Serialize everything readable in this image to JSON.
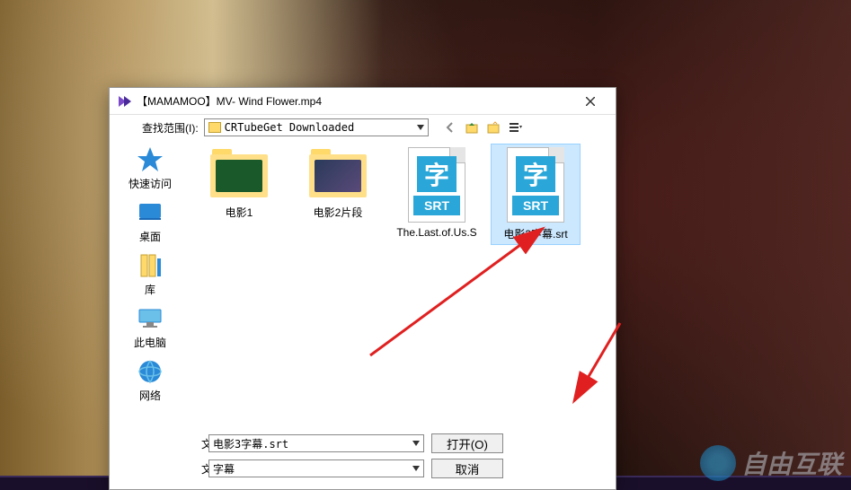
{
  "window": {
    "title": "【MAMAMOO】MV- Wind Flower.mp4"
  },
  "lookIn": {
    "label": "查找范围(I):",
    "folder": "CRTubeGet Downloaded"
  },
  "sidebar": [
    {
      "label": "快速访问",
      "key": "quick"
    },
    {
      "label": "桌面",
      "key": "desktop"
    },
    {
      "label": "库",
      "key": "library"
    },
    {
      "label": "此电脑",
      "key": "pc"
    },
    {
      "label": "网络",
      "key": "network"
    }
  ],
  "files": [
    {
      "label": "电影1",
      "type": "folder",
      "thumb": "#1a5a2a"
    },
    {
      "label": "电影2片段",
      "type": "folder",
      "thumb": "#2a3a5a"
    },
    {
      "label": "The.Last.of.Us.S",
      "type": "srt"
    },
    {
      "label": "电影3字幕.srt",
      "type": "srt",
      "selected": true
    }
  ],
  "filename": {
    "label": "文件名(N):",
    "value": "电影3字幕.srt"
  },
  "filetype": {
    "label": "文件类型(T):",
    "value": "字幕"
  },
  "buttons": {
    "open": "打开(O)",
    "cancel": "取消"
  },
  "srt": {
    "char": "字",
    "ext": "SRT"
  },
  "watermark": "自由互联"
}
